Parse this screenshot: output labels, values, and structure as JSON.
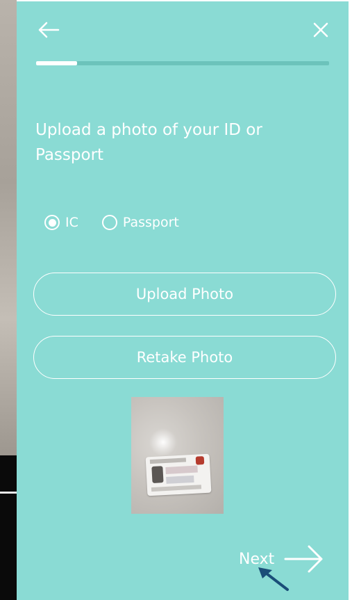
{
  "header": {
    "back_icon": "arrow-left-icon",
    "close_icon": "close-icon",
    "progress": 0.14
  },
  "main": {
    "title": "Upload a photo of your ID or Passport",
    "id_type": {
      "options": [
        {
          "label": "IC",
          "selected": true
        },
        {
          "label": "Passport",
          "selected": false
        }
      ]
    },
    "upload_button_label": "Upload Photo",
    "retake_button_label": "Retake Photo"
  },
  "footer": {
    "next_label": "Next",
    "next_icon": "arrow-right-icon"
  },
  "colors": {
    "panel_bg": "#8adbd4",
    "accent": "#ffffff",
    "cursor": "#1a4e78"
  }
}
